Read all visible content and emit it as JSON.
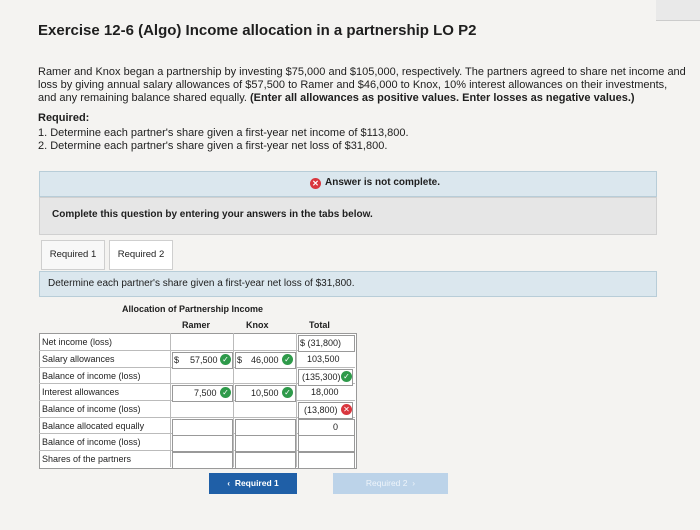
{
  "title": "Exercise 12-6 (Algo) Income allocation in a partnership LO P2",
  "intro": {
    "text": "Ramer and Knox began a partnership by investing $75,000 and $105,000, respectively. The partners agreed to share net income and loss by giving annual salary allowances of $57,500 to Ramer and $46,000 to Knox, 10% interest allowances on their investments, and any remaining balance shared equally.",
    "bold": "(Enter all allowances as positive values. Enter losses as negative values.)"
  },
  "required": {
    "heading": "Required:",
    "items": [
      "1. Determine each partner's share given a first-year net income of $113,800.",
      "2. Determine each partner's share given a first-year net loss of $31,800."
    ]
  },
  "status": {
    "icon": "x-icon",
    "text": "Answer is not complete."
  },
  "complete_text": "Complete this question by entering your answers in the tabs below.",
  "tabs": [
    "Required 1",
    "Required 2"
  ],
  "content_text": "Determine each partner's share given a first-year net loss of $31,800.",
  "table": {
    "title": "Allocation of Partnership Income",
    "columns": [
      "Ramer",
      "Knox",
      "Total"
    ],
    "rows": [
      "Net income (loss)",
      "Salary allowances",
      "Balance of income (loss)",
      "Interest allowances",
      "Balance of income (loss)",
      "Balance allocated equally",
      "Balance of income (loss)",
      "Shares of the partners"
    ],
    "values": {
      "net_income_total": "$ (31,800)",
      "salary_ramer_prefix": "$",
      "salary_ramer": "57,500",
      "salary_knox_prefix": "$",
      "salary_knox": "46,000",
      "salary_total": "103,500",
      "balance1_total": "(135,300)",
      "interest_ramer": "7,500",
      "interest_knox": "10,500",
      "interest_total": "18,000",
      "balance2_total": "(13,800)",
      "allocated_total": "0"
    }
  },
  "nav": {
    "prev": "Required 1",
    "next": "Required 2"
  },
  "colors": {
    "accent": "#1f5fa7",
    "ok": "#2e9a4a",
    "error": "#d9363e"
  }
}
